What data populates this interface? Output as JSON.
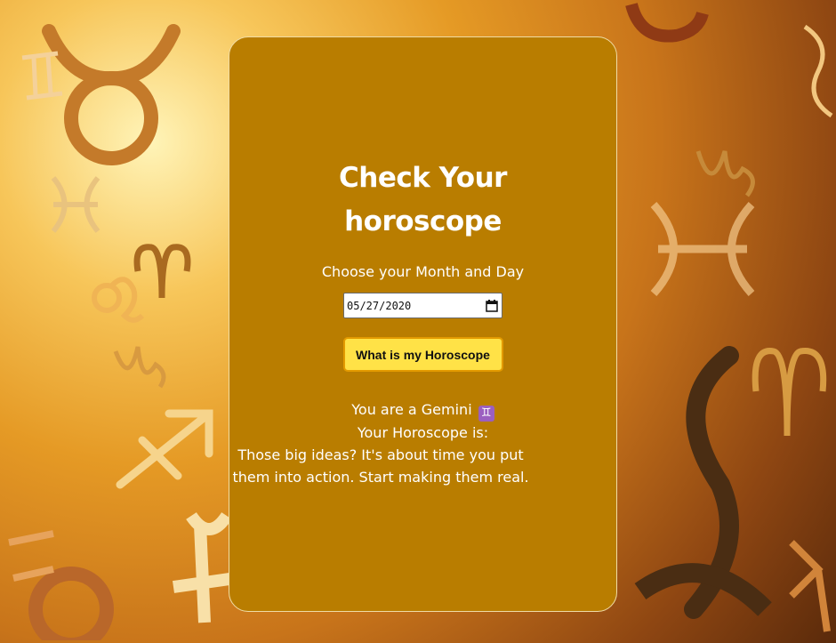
{
  "title": "Check Your horoscope",
  "form": {
    "prompt": "Choose your Month and Day",
    "date_value": "05/27/2020",
    "button_label": "What is my Horoscope"
  },
  "result": {
    "sign_text": "You are a Gemini",
    "sign_emoji": "♊",
    "heading": "Your Horoscope is:",
    "horoscope": "Those big ideas? It's about time you put them into action. Start making them real."
  },
  "icons": {
    "calendar": "calendar-icon"
  },
  "colors": {
    "card": "#b97d00",
    "button": "#ffe247",
    "button_border": "#e39a00",
    "text": "#ffffff",
    "gemini_emoji_bg": "#9b5fc0"
  }
}
